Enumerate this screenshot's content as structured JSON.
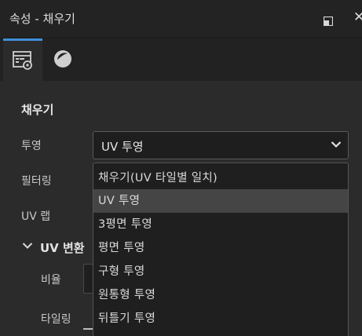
{
  "window": {
    "title": "속성 - 채우기"
  },
  "tabs": [
    {
      "icon": "fill-properties-icon"
    },
    {
      "icon": "material-sphere-icon"
    }
  ],
  "section": {
    "title": "채우기"
  },
  "fields": {
    "projection": {
      "label": "투영",
      "value": "UV 투영"
    },
    "filtering": {
      "label": "필터링"
    },
    "uv_wrap": {
      "label": "UV 랩"
    }
  },
  "uv_transform": {
    "label": "UV 변환",
    "ratio_label": "비율",
    "tiling_label": "타일링"
  },
  "dropdown": {
    "options": [
      "채우기(UV 타일별 일치)",
      "UV 투영",
      "3평면 투영",
      "평면 투영",
      "구형 투영",
      "원통형 투영",
      "뒤틀기 투영"
    ],
    "selected": "UV 투영"
  },
  "colors": {
    "accent": "#3f8fd8",
    "background": "#2b2b2b",
    "dropdown_bg": "#1f1f1f",
    "selected_bg": "#454545"
  }
}
